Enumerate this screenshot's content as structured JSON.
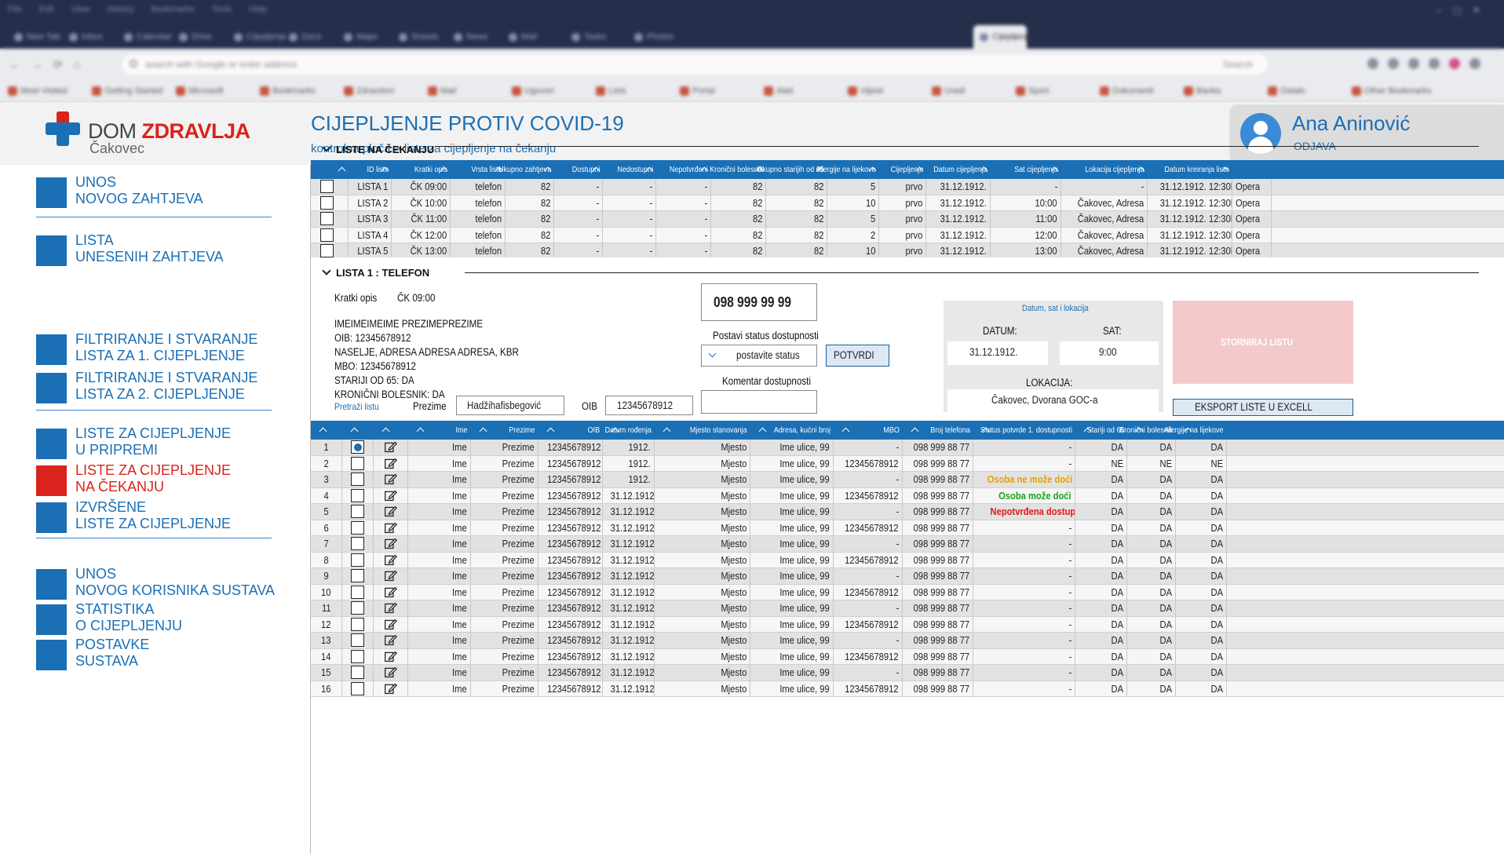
{
  "browser": {
    "top_menu": [
      "File",
      "Edit",
      "View",
      "History",
      "Bookmarks",
      "Tools",
      "Help"
    ],
    "tabs": [
      "New Tab",
      "Inbox",
      "Calendar",
      "Drive",
      "Cijepljenje",
      "Docs",
      "Maps",
      "Sheets",
      "News",
      "Mail",
      "Tasks",
      "Photos",
      "Cijepljenje"
    ],
    "active_tab": "Cijepljenje",
    "url": "search with Google or enter address",
    "search": "Search",
    "bookmarks": [
      "Most Visited",
      "Getting Started",
      "Microsoft",
      "Bookmarks",
      "Zdravstvo",
      "Mail",
      "Ugovori",
      "Lists",
      "Portal",
      "Alati",
      "Vijesti",
      "Uredi",
      "Sport",
      "Dokumenti",
      "Banka",
      "Ostalo",
      "Other Bookmarks"
    ]
  },
  "brand": {
    "dom": "DOM ",
    "zdravlja": "ZDRAVLJA",
    "city": "Čakovec"
  },
  "page": {
    "title": "CIJEPLJENJE PROTIV COVID-19",
    "breadcrumb": "kontrolna ploča > liste za cijepljenje na čekanju"
  },
  "user": {
    "name": "Ana Aninović",
    "logout": "ODJAVA"
  },
  "sidebar": {
    "items": [
      {
        "l1": "UNOS",
        "l2": "NOVOG ZAHTJEVA"
      },
      {
        "l1": "LISTA",
        "l2": "UNESENIH ZAHTJEVA"
      },
      {
        "l1": "FILTRIRANJE I STVARANJE",
        "l2": "LISTA ZA 1. CIJEPLJENJE"
      },
      {
        "l1": "FILTRIRANJE I STVARANJE",
        "l2": "LISTA ZA 2. CIJEPLJENJE"
      },
      {
        "l1": "LISTE ZA CIJEPLJENJE",
        "l2": "U PRIPREMI"
      },
      {
        "l1": "LISTE ZA CIJEPLJENJE",
        "l2": "NA ČEKANJU"
      },
      {
        "l1": "IZVRŠENE",
        "l2": "LISTE ZA CIJEPLJENJE"
      },
      {
        "l1": "UNOS",
        "l2": "NOVOG KORISNIKA SUSTAVA"
      },
      {
        "l1": "STATISTIKA",
        "l2": "O CIJEPLJENJU"
      },
      {
        "l1": "POSTAVKE",
        "l2": "SUSTAVA"
      }
    ],
    "active_index": 5
  },
  "lists": {
    "section_title": "LISTE NA ČEKANJU",
    "headers": [
      "",
      "ID liste",
      "Kratki opis",
      "Vrsta liste",
      "Ukupno zahtjeva",
      "Dostupni",
      "Nedostupni",
      "Nepotvrđeni",
      "Kronični bolesnik",
      "Ukupno starijih od 65",
      "Alergije na lijekove",
      "Cijepljenje",
      "Datum cijepljenja",
      "Sat cijepljenja",
      "Lokacija cijepljenja",
      "Datum kreiranja liste",
      ""
    ],
    "rows": [
      [
        "LISTA 1",
        "ČK 09:00",
        "telefon",
        "82",
        "-",
        "-",
        "-",
        "82",
        "82",
        "5",
        "prvo",
        "31.12.1912.",
        "-",
        "-",
        "31.12.1912. 12:30h",
        "Opera"
      ],
      [
        "LISTA 2",
        "ČK 10:00",
        "telefon",
        "82",
        "-",
        "-",
        "-",
        "82",
        "82",
        "10",
        "prvo",
        "31.12.1912.",
        "10:00",
        "Čakovec, Adresa",
        "31.12.1912. 12:30h",
        "Opera"
      ],
      [
        "LISTA 3",
        "ČK 11:00",
        "telefon",
        "82",
        "-",
        "-",
        "-",
        "82",
        "82",
        "5",
        "prvo",
        "31.12.1912.",
        "11:00",
        "Čakovec, Adresa",
        "31.12.1912. 12:30h",
        "Opera"
      ],
      [
        "LISTA 4",
        "ČK 12:00",
        "telefon",
        "82",
        "-",
        "-",
        "-",
        "82",
        "82",
        "2",
        "prvo",
        "31.12.1912.",
        "12:00",
        "Čakovec, Adresa",
        "31.12.1912. 12:30h",
        "Opera"
      ],
      [
        "LISTA 5",
        "ČK 13:00",
        "telefon",
        "82",
        "-",
        "-",
        "-",
        "82",
        "82",
        "10",
        "prvo",
        "31.12.1912.",
        "13:00",
        "Čakovec, Adresa",
        "31.12.1912. 12:30h",
        "Opera"
      ]
    ]
  },
  "detail": {
    "section_title": "LISTA 1 : TELEFON",
    "kratki_opis_label": "Kratki opis",
    "kratki_opis_value": "ČK 09:00",
    "patient": [
      "IMEIMEIMEIME  PREZIMEPREZIME",
      "OIB: 12345678912",
      "NASELJE, ADRESA ADRESA ADRESA, KBR",
      "MBO: 12345678912",
      "STARIJI OD 65: DA",
      "KRONIČNI BOLESNIK: DA"
    ],
    "search_link": "Pretraži listu",
    "prezime_label": "Prezime",
    "prezime_value": "Hadžihafisbegović",
    "oib_label": "OIB",
    "oib_value": "12345678912",
    "phone": "098 999 99 99",
    "status_label": "Postavi status dostupnosti",
    "status_select": "postavite status",
    "confirm": "POTVRDI",
    "comment_label": "Komentar dostupnosti",
    "comment_value": "",
    "dsl_title": "Datum, sat i lokacija",
    "datum_label": "DATUM:",
    "datum_value": "31.12.1912.",
    "sat_label": "SAT:",
    "sat_value": "9:00",
    "lokacija_label": "LOKACIJA:",
    "lokacija_value": "Čakovec, Dvorana GOC-a",
    "cancel": "STORNIRAJ LISTU",
    "export": "EKSPORT LISTE U EXCELL"
  },
  "people": {
    "headers": [
      "",
      "",
      "",
      "Ime",
      "Prezime",
      "OIB",
      "Datum rođenja",
      "Mjesto stanovanja",
      "Adresa, kućni broj",
      "MBO",
      "Broj telefona",
      "Status potvrde 1. dostupnosti",
      "Stariji od 65",
      "Kronični bolesnik",
      "Alergije na lijekove"
    ],
    "selected_row": 0,
    "rows": [
      [
        "1",
        "Ime",
        "Prezime",
        "12345678912",
        "1912.",
        "Mjesto",
        "Ime ulice, 99",
        "-",
        "098 999 88 77",
        "-",
        "DA",
        "DA",
        "DA",
        ""
      ],
      [
        "2",
        "Ime",
        "Prezime",
        "12345678912",
        "1912.",
        "Mjesto",
        "Ime ulice, 99",
        "12345678912",
        "098 999 88 77",
        "-",
        "NE",
        "NE",
        "NE",
        ""
      ],
      [
        "3",
        "Ime",
        "Prezime",
        "12345678912",
        "1912.",
        "Mjesto",
        "Ime ulice, 99",
        "-",
        "098 999 88 77",
        "Osoba ne može doći",
        "DA",
        "DA",
        "DA",
        "warn"
      ],
      [
        "4",
        "Ime",
        "Prezime",
        "12345678912",
        "31.12.1912.",
        "Mjesto",
        "Ime ulice, 99",
        "12345678912",
        "098 999 88 77",
        "Osoba može doći",
        "DA",
        "DA",
        "DA",
        "ok"
      ],
      [
        "5",
        "Ime",
        "Prezime",
        "12345678912",
        "31.12.1912.",
        "Mjesto",
        "Ime ulice, 99",
        "-",
        "098 999 88 77",
        "Nepotvrđena dostupnost",
        "DA",
        "DA",
        "DA",
        "bad"
      ],
      [
        "6",
        "Ime",
        "Prezime",
        "12345678912",
        "31.12.1912.",
        "Mjesto",
        "Ime ulice, 99",
        "12345678912",
        "098 999 88 77",
        "-",
        "DA",
        "DA",
        "DA",
        ""
      ],
      [
        "7",
        "Ime",
        "Prezime",
        "12345678912",
        "31.12.1912.",
        "Mjesto",
        "Ime ulice, 99",
        "-",
        "098 999 88 77",
        "-",
        "DA",
        "DA",
        "DA",
        ""
      ],
      [
        "8",
        "Ime",
        "Prezime",
        "12345678912",
        "31.12.1912.",
        "Mjesto",
        "Ime ulice, 99",
        "12345678912",
        "098 999 88 77",
        "-",
        "DA",
        "DA",
        "DA",
        ""
      ],
      [
        "9",
        "Ime",
        "Prezime",
        "12345678912",
        "31.12.1912.",
        "Mjesto",
        "Ime ulice, 99",
        "-",
        "098 999 88 77",
        "-",
        "DA",
        "DA",
        "DA",
        ""
      ],
      [
        "10",
        "Ime",
        "Prezime",
        "12345678912",
        "31.12.1912.",
        "Mjesto",
        "Ime ulice, 99",
        "12345678912",
        "098 999 88 77",
        "-",
        "DA",
        "DA",
        "DA",
        ""
      ],
      [
        "11",
        "Ime",
        "Prezime",
        "12345678912",
        "31.12.1912.",
        "Mjesto",
        "Ime ulice, 99",
        "-",
        "098 999 88 77",
        "-",
        "DA",
        "DA",
        "DA",
        ""
      ],
      [
        "12",
        "Ime",
        "Prezime",
        "12345678912",
        "31.12.1912.",
        "Mjesto",
        "Ime ulice, 99",
        "12345678912",
        "098 999 88 77",
        "-",
        "DA",
        "DA",
        "DA",
        ""
      ],
      [
        "13",
        "Ime",
        "Prezime",
        "12345678912",
        "31.12.1912.",
        "Mjesto",
        "Ime ulice, 99",
        "-",
        "098 999 88 77",
        "-",
        "DA",
        "DA",
        "DA",
        ""
      ],
      [
        "14",
        "Ime",
        "Prezime",
        "12345678912",
        "31.12.1912.",
        "Mjesto",
        "Ime ulice, 99",
        "12345678912",
        "098 999 88 77",
        "-",
        "DA",
        "DA",
        "DA",
        ""
      ],
      [
        "15",
        "Ime",
        "Prezime",
        "12345678912",
        "31.12.1912.",
        "Mjesto",
        "Ime ulice, 99",
        "-",
        "098 999 88 77",
        "-",
        "DA",
        "DA",
        "DA",
        ""
      ],
      [
        "16",
        "Ime",
        "Prezime",
        "12345678912",
        "31.12.1912.",
        "Mjesto",
        "Ime ulice, 99",
        "12345678912",
        "098 999 88 77",
        "-",
        "DA",
        "DA",
        "DA",
        ""
      ]
    ]
  },
  "colors": {
    "brand_blue": "#1a6fb5",
    "brand_red": "#d9231c",
    "status_warn": "#e8a000",
    "status_ok": "#1aa31a",
    "status_bad": "#e01818"
  },
  "icons": [
    "dom-zdravlja-cross-icon",
    "user-avatar-icon",
    "chevron-down-icon",
    "sort-caret-icon",
    "checkbox-icon",
    "edit-icon"
  ]
}
